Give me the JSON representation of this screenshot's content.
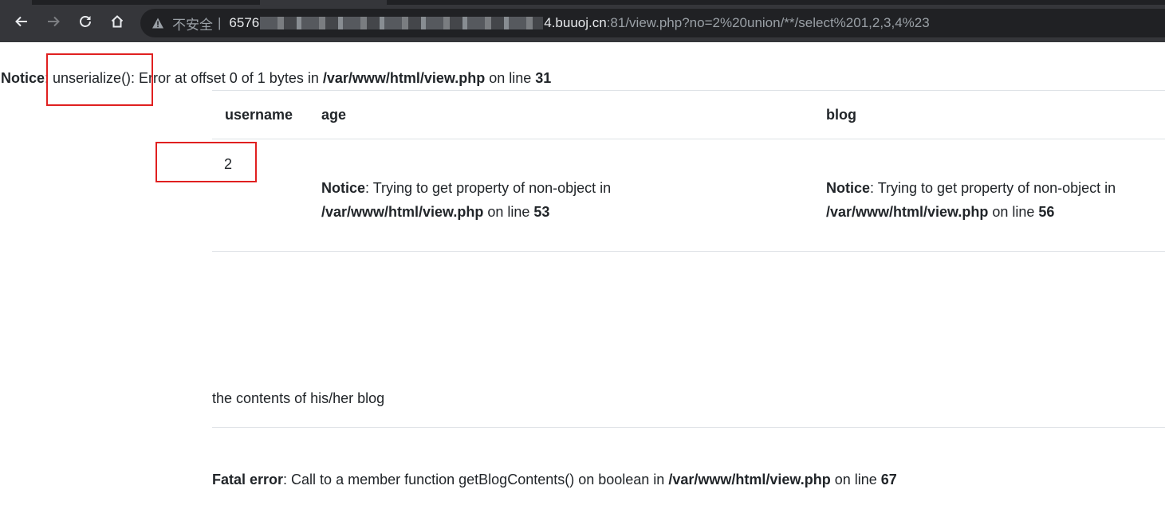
{
  "browser": {
    "back_icon": "arrow-left-icon",
    "forward_icon": "arrow-right-icon",
    "reload_icon": "reload-icon",
    "home_icon": "home-icon",
    "security_icon": "warning-triangle-icon",
    "insecure_label": "不安全",
    "separator": "|",
    "url_prefix": "6576",
    "url_host_suffix": "4.buuoj.cn",
    "url_path": ":81/view.php?no=2%20union/**/select%201,2,3,4%23"
  },
  "top_notice": {
    "label": "Notice",
    "message": ": unserialize(): Error at offset 0 of 1 bytes in ",
    "file": "/var/www/html/view.php",
    "on_line": " on line ",
    "line": "31"
  },
  "table": {
    "headers": [
      "username",
      "age",
      "blog"
    ],
    "row": {
      "username": "2",
      "age_notice": {
        "label": "Notice",
        "message": ": Trying to get property of non-object in",
        "file": "/var/www/html/view.php",
        "on_line": " on line ",
        "line": "53"
      },
      "blog_notice": {
        "label": "Notice",
        "message": ": Trying to get property of non-object in",
        "file": "/var/www/html/view.php",
        "on_line": " on line ",
        "line": "56"
      }
    }
  },
  "blog_text": "the contents of his/her blog",
  "fatal": {
    "label": "Fatal error",
    "message": ": Call to a member function getBlogContents() on boolean in ",
    "file": "/var/www/html/view.php",
    "on_line": " on line ",
    "line": "67"
  },
  "colors": {
    "toolbar": "#35363a",
    "omnibox": "#202124",
    "annotation_box": "#e02020",
    "divider": "#dee2e6"
  }
}
